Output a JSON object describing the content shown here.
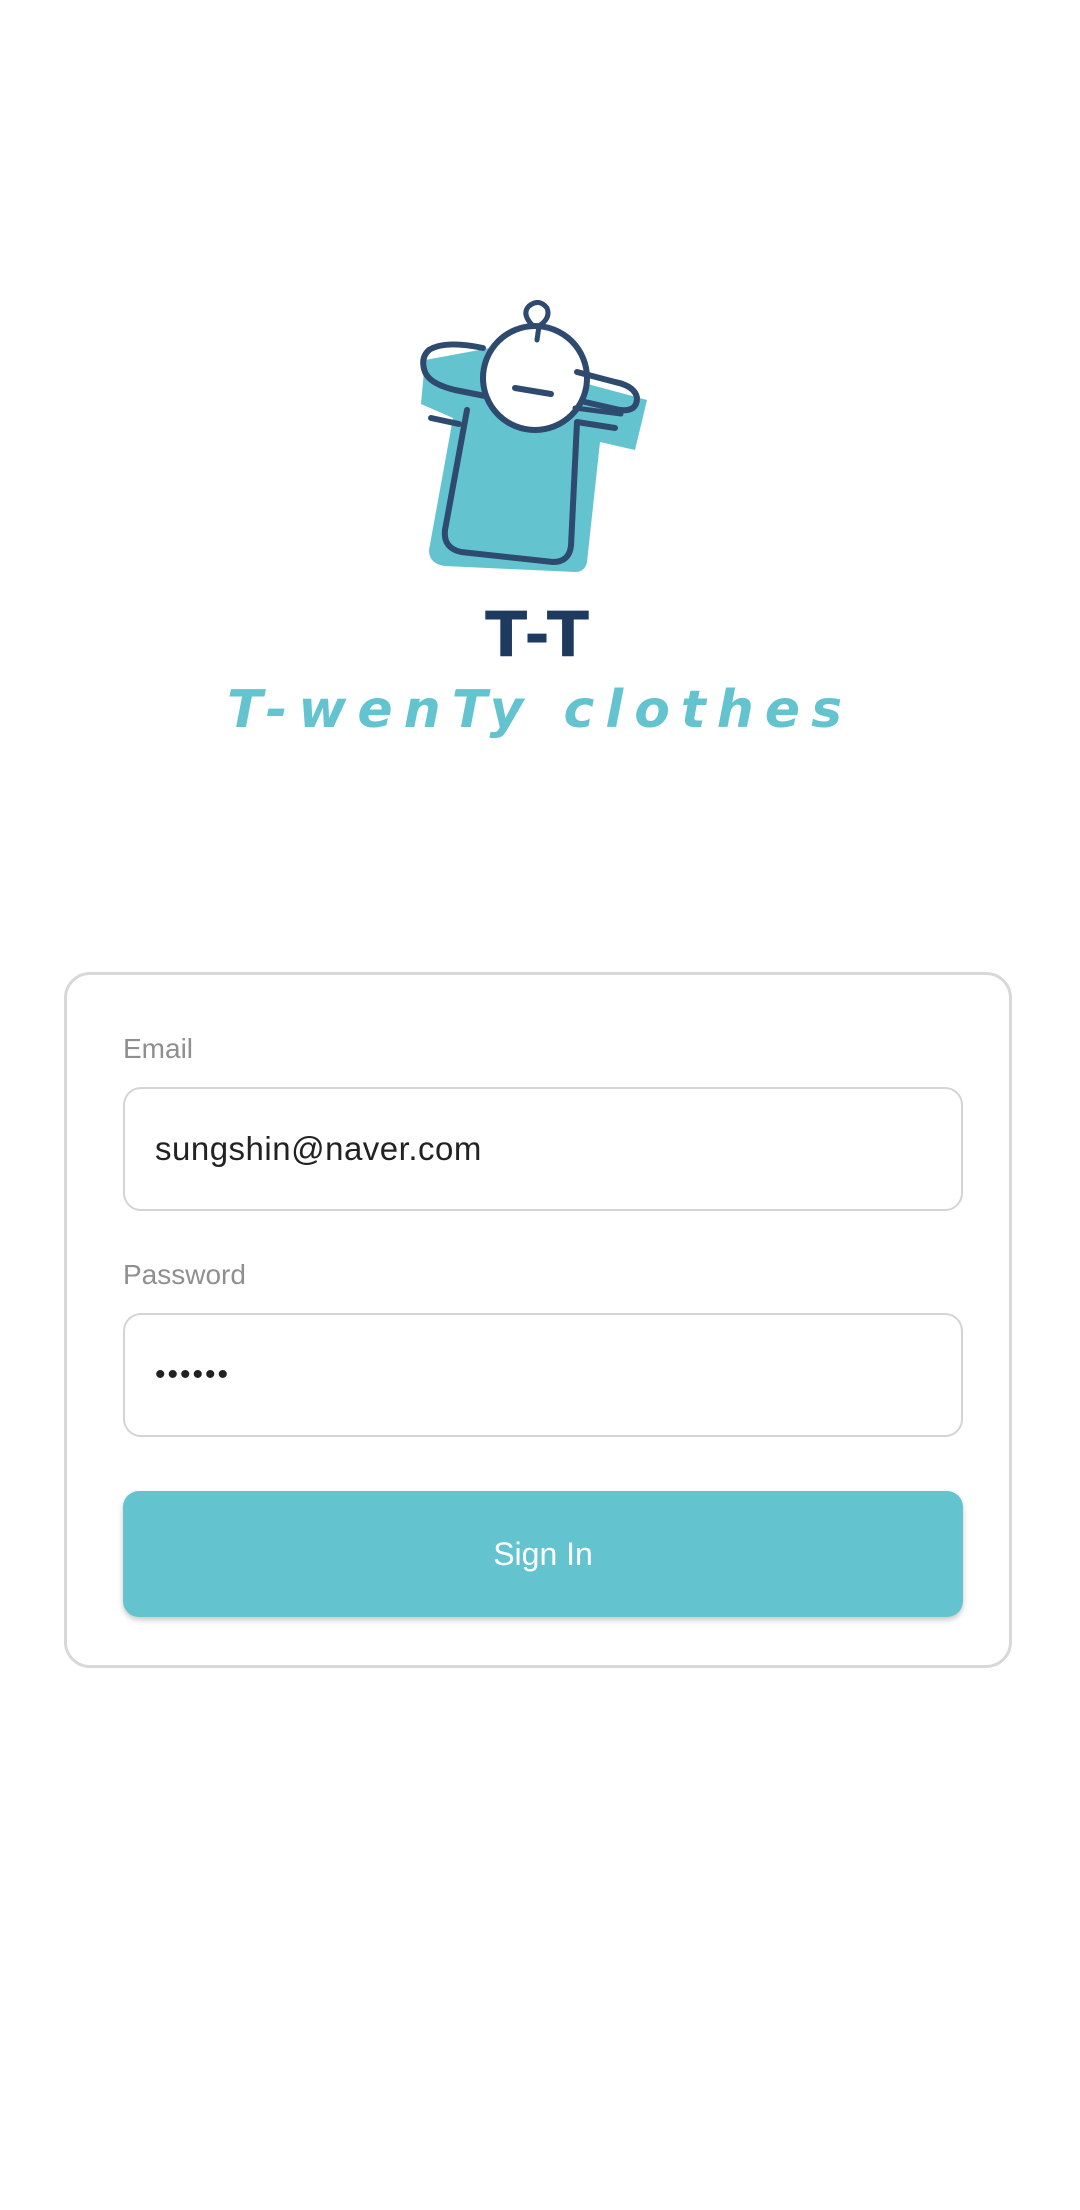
{
  "brand": {
    "short_name": "T-T",
    "full_name": "T-wenTy clothes",
    "icon": "shirt-hanger-logo",
    "primary_color": "#63c4d0",
    "dark_color": "#1f3a5f"
  },
  "login": {
    "email_label": "Email",
    "email_value": "sungshin@naver.com",
    "password_label": "Password",
    "password_value": "••••••",
    "sign_in_label": "Sign In"
  }
}
